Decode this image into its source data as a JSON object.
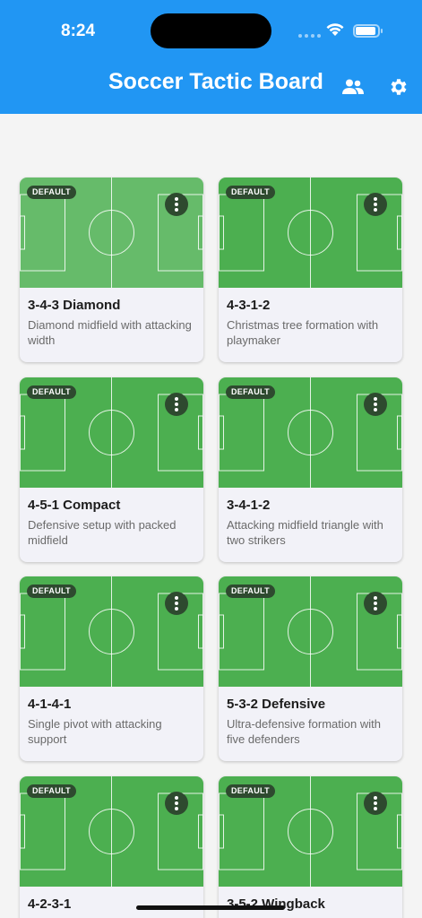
{
  "status_bar": {
    "time": "8:24"
  },
  "header": {
    "title": "Soccer Tactic Board",
    "icons": [
      "people-icon",
      "settings-icon"
    ]
  },
  "colors": {
    "app_bar": "#2196f3",
    "field": "#4caf50",
    "field_highlight": "#66bb6a",
    "badge": "#2e4a2f"
  },
  "formations": [
    {
      "name": "3-4-3 Diamond",
      "description": "Diamond midfield with attacking width",
      "badge": "DEFAULT",
      "highlighted": true
    },
    {
      "name": "4-3-1-2",
      "description": "Christmas tree formation with playmaker",
      "badge": "DEFAULT",
      "highlighted": false
    },
    {
      "name": "4-5-1 Compact",
      "description": "Defensive setup with packed midfield",
      "badge": "DEFAULT",
      "highlighted": false
    },
    {
      "name": "3-4-1-2",
      "description": "Attacking midfield triangle with two strikers",
      "badge": "DEFAULT",
      "highlighted": false
    },
    {
      "name": "4-1-4-1",
      "description": "Single pivot with attacking support",
      "badge": "DEFAULT",
      "highlighted": false
    },
    {
      "name": "5-3-2 Defensive",
      "description": "Ultra-defensive formation with five defenders",
      "badge": "DEFAULT",
      "highlighted": false
    },
    {
      "name": "4-2-3-1",
      "description": "",
      "badge": "DEFAULT",
      "highlighted": false
    },
    {
      "name": "3-5-2 Wingback",
      "description": "",
      "badge": "DEFAULT",
      "highlighted": false
    }
  ]
}
